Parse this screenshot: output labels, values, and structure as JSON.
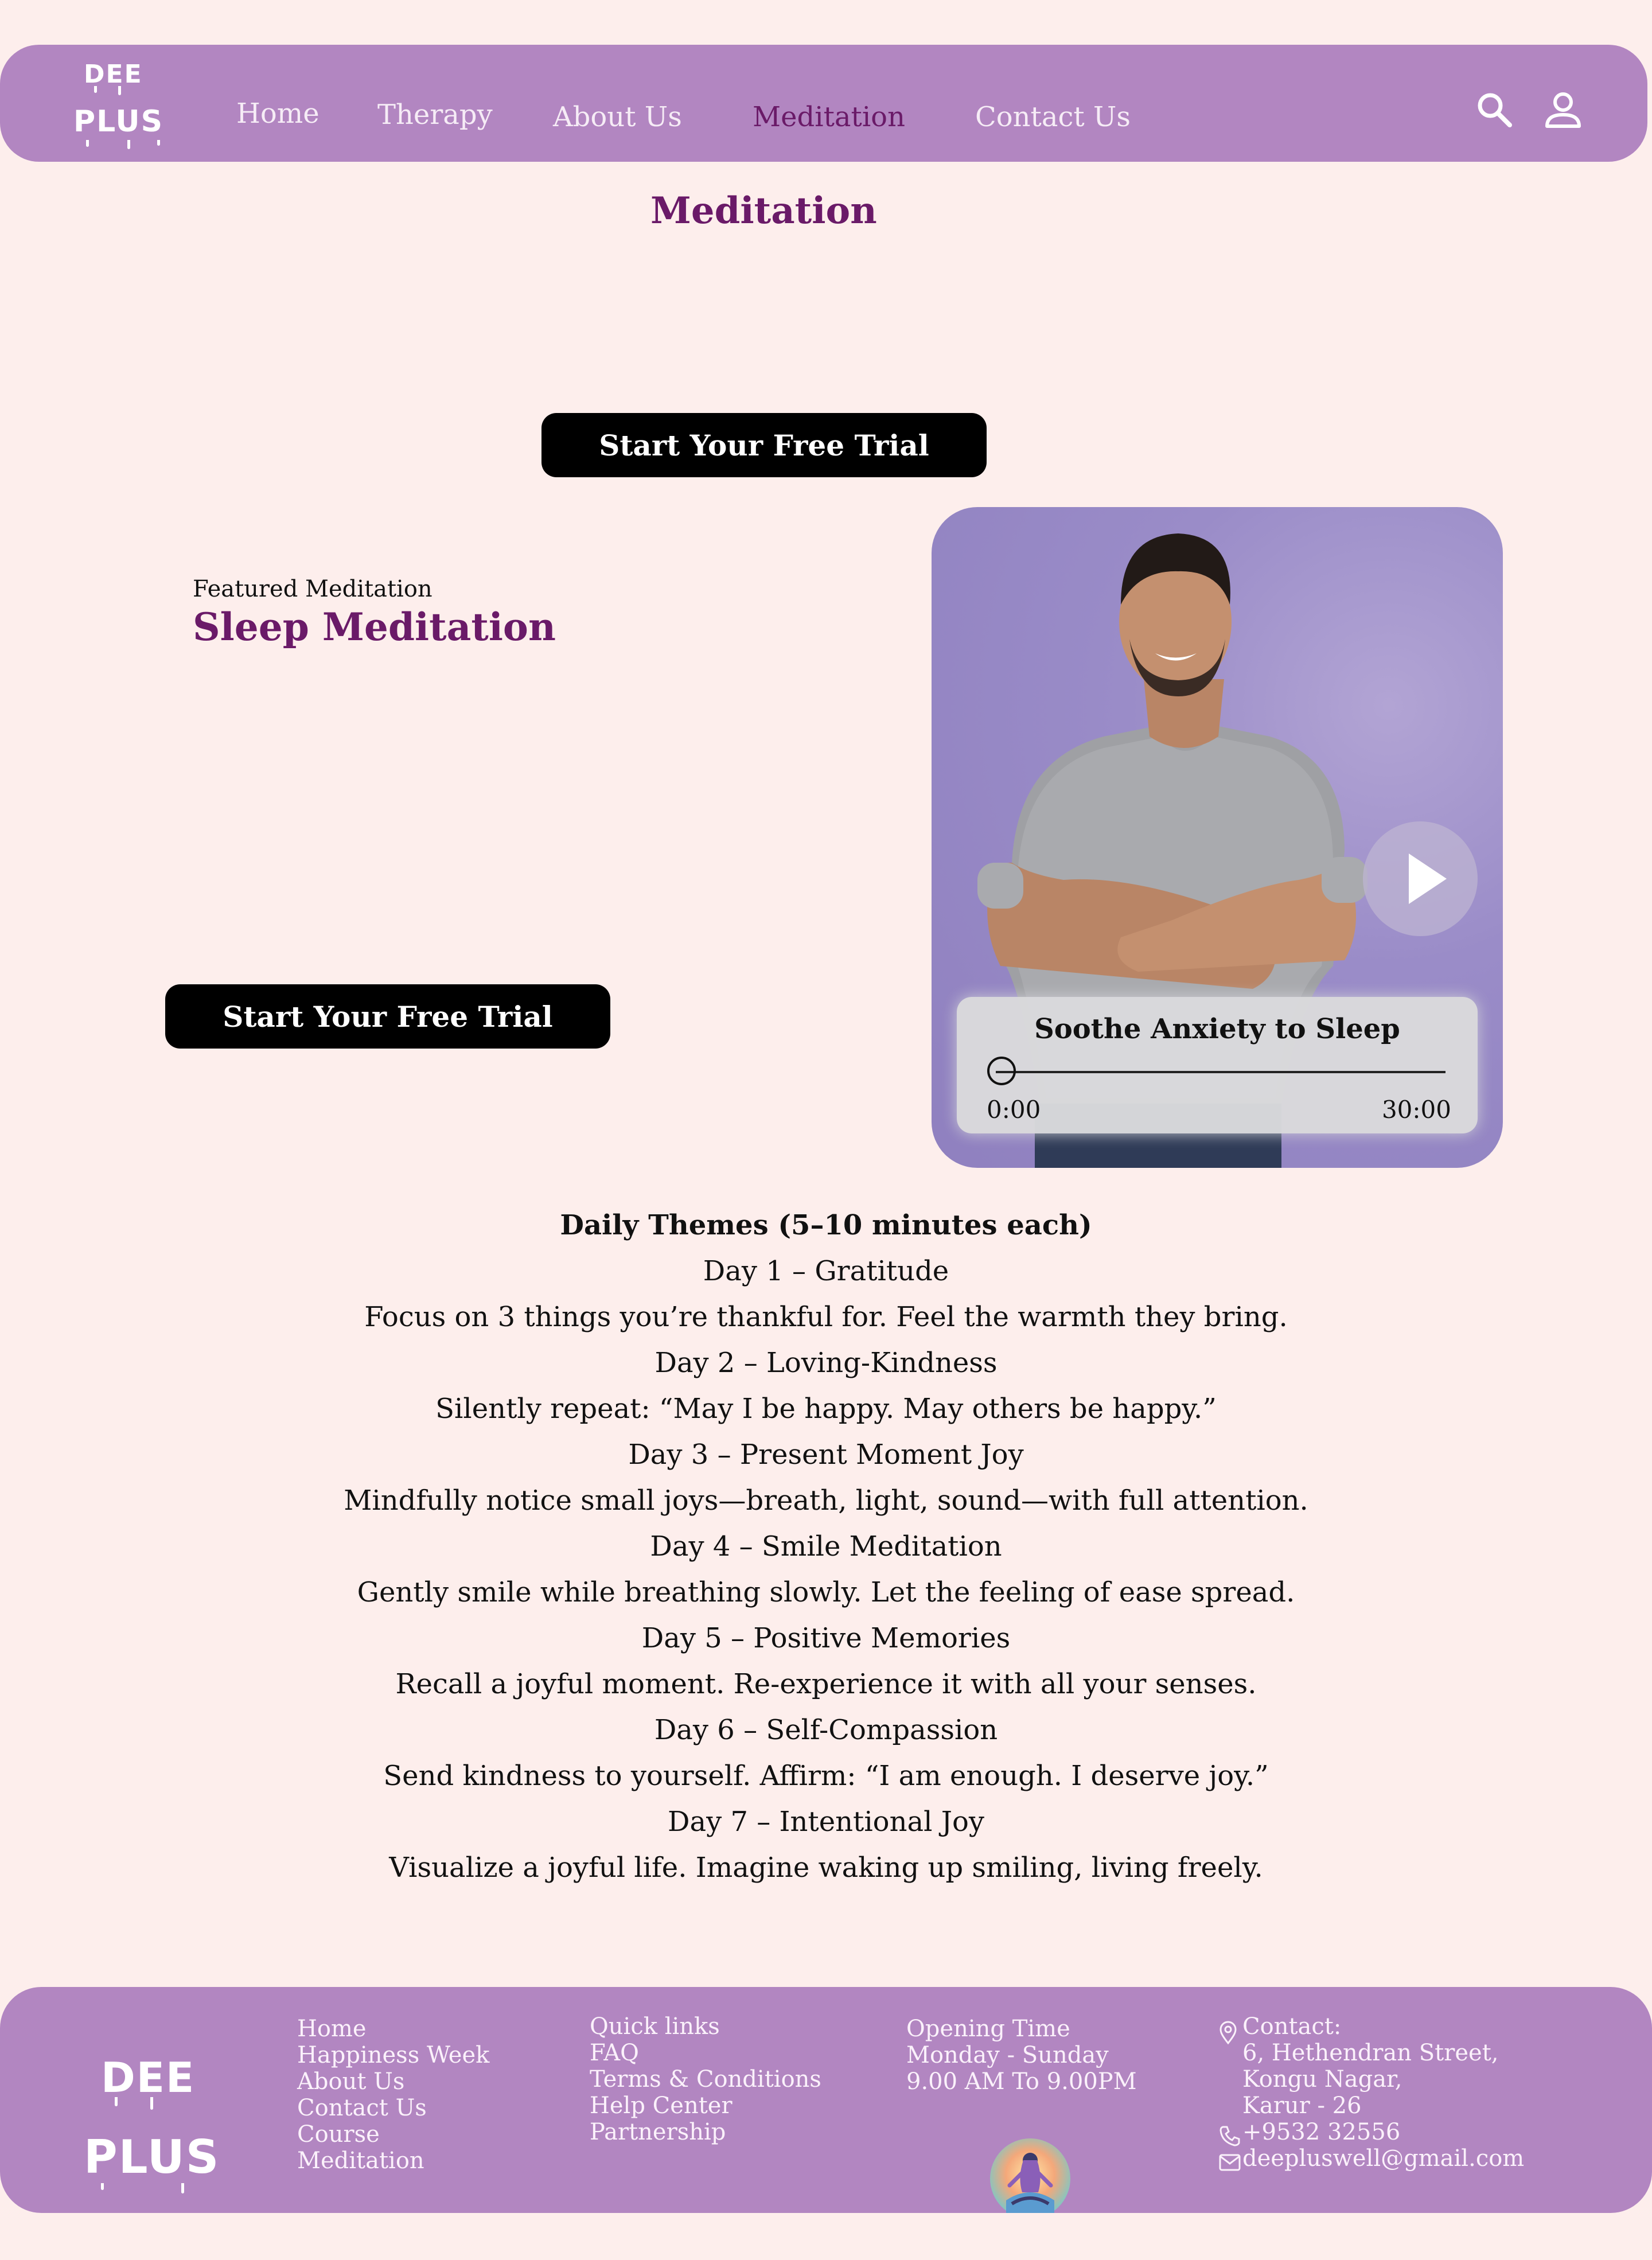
{
  "brand": {
    "logo_top": "DEE",
    "logo_bottom": "PLUS"
  },
  "nav": {
    "items": [
      {
        "label": "Home"
      },
      {
        "label": "Therapy"
      },
      {
        "label": "About Us"
      },
      {
        "label": "Meditation",
        "active": true
      },
      {
        "label": "Contact Us"
      }
    ],
    "icons": [
      "search-icon",
      "user-icon"
    ]
  },
  "page": {
    "title": "Meditation",
    "cta_top": "Start Your Free Trial"
  },
  "featured": {
    "kicker": "Featured Meditation",
    "title": "Sleep Meditation",
    "cta": "Start Your Free Trial"
  },
  "player": {
    "track_title": "Soothe Anxiety to Sleep",
    "current_time": "0:00",
    "duration": "30:00",
    "progress": 0
  },
  "themes": {
    "heading": "Daily Themes (5–10 minutes each)",
    "days": [
      {
        "title": "Day 1 – Gratitude",
        "text": "Focus on 3 things you’re thankful for. Feel the warmth they bring."
      },
      {
        "title": "Day 2 – Loving-Kindness",
        "text": "Silently repeat: “May I be happy. May others be happy.”"
      },
      {
        "title": "Day 3 – Present Moment Joy",
        "text": "Mindfully notice small joys—breath, light, sound—with full attention."
      },
      {
        "title": "Day 4 – Smile Meditation",
        "text": "Gently smile while breathing slowly. Let the feeling of ease spread."
      },
      {
        "title": "Day 5 – Positive Memories",
        "text": "Recall a joyful moment. Re-experience it with all your senses."
      },
      {
        "title": "Day 6 – Self-Compassion",
        "text": "Send kindness to yourself. Affirm: “I am enough. I deserve joy.”"
      },
      {
        "title": "Day 7 – Intentional Joy",
        "text": "Visualize a joyful life. Imagine waking up smiling, living freely."
      }
    ]
  },
  "footer": {
    "nav_links": [
      "Home",
      "Happiness Week",
      "About Us",
      "Contact Us",
      "Course",
      "Meditation"
    ],
    "quick_links": [
      "Quick links",
      "FAQ",
      "Terms & Conditions",
      "Help Center",
      "Partnership"
    ],
    "hours": [
      "Opening Time",
      "Monday - Sunday",
      "9.00 AM To 9.00PM"
    ],
    "contact": {
      "heading": "Contact:",
      "address": [
        "6, Hethendran Street,",
        "Kongu Nagar,",
        "Karur - 26"
      ],
      "phone": "+9532 32556",
      "email": "deepluswell@gmail.com"
    }
  },
  "colors": {
    "nav_bg": "#b286c1",
    "accent": "#6a1a68",
    "page_bg": "#fdeeec",
    "button_bg": "#000000"
  }
}
